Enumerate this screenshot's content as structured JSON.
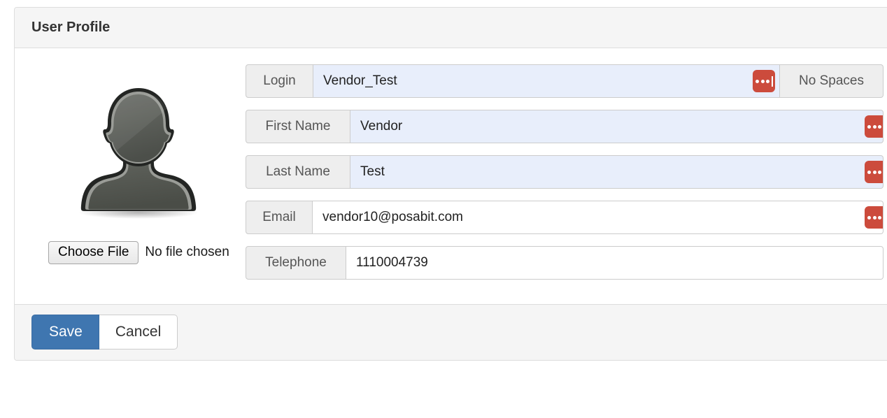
{
  "panel": {
    "title": "User Profile"
  },
  "avatar": {
    "icon": "user-silhouette-avatar"
  },
  "file_upload": {
    "button_label": "Choose File",
    "status_text": "No file chosen"
  },
  "form": {
    "fields": [
      {
        "label": "Login",
        "value": "Vendor_Test",
        "placeholder": "",
        "autofilled": true,
        "badge_icon": "masked-text-icon",
        "badge_color": "#cc4b3c",
        "addon_right": "No Spaces"
      },
      {
        "label": "First Name",
        "value": "Vendor",
        "placeholder": "",
        "autofilled": true,
        "badge_icon": "masked-text-icon",
        "badge_color": "#cc4b3c",
        "addon_right": ""
      },
      {
        "label": "Last Name",
        "value": "Test",
        "placeholder": "",
        "autofilled": true,
        "badge_icon": "masked-text-icon",
        "badge_color": "#cc4b3c",
        "addon_right": ""
      },
      {
        "label": "Email",
        "value": "vendor10@posabit.com",
        "placeholder": "",
        "autofilled": false,
        "badge_icon": "masked-text-icon",
        "badge_color": "#cc4b3c",
        "addon_right": ""
      },
      {
        "label": "Telephone",
        "value": "1110004739",
        "placeholder": "",
        "autofilled": false,
        "badge_icon": "",
        "badge_color": "",
        "addon_right": ""
      }
    ]
  },
  "footer": {
    "save_label": "Save",
    "cancel_label": "Cancel",
    "save_color": "#3f76b0"
  }
}
